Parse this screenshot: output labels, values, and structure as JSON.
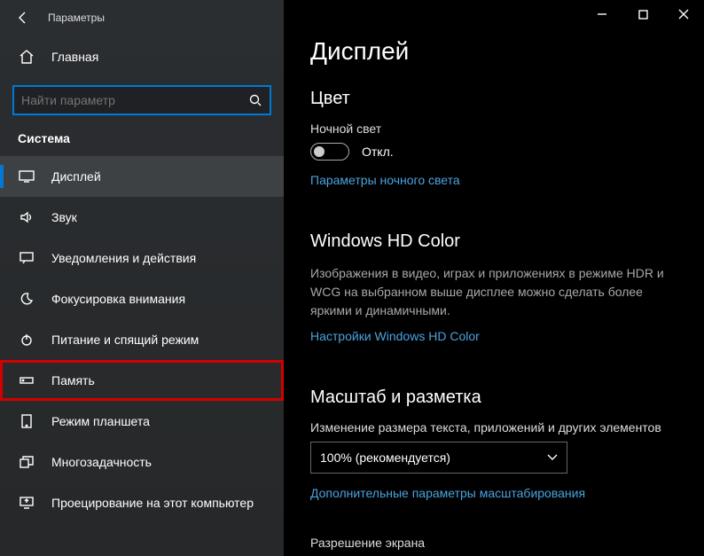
{
  "titlebar": {
    "title": "Параметры"
  },
  "home_label": "Главная",
  "search": {
    "placeholder": "Найти параметр"
  },
  "section_title": "Система",
  "nav": [
    {
      "label": "Дисплей"
    },
    {
      "label": "Звук"
    },
    {
      "label": "Уведомления и действия"
    },
    {
      "label": "Фокусировка внимания"
    },
    {
      "label": "Питание и спящий режим"
    },
    {
      "label": "Память"
    },
    {
      "label": "Режим планшета"
    },
    {
      "label": "Многозадачность"
    },
    {
      "label": "Проецирование на этот компьютер"
    }
  ],
  "content": {
    "page_title": "Дисплей",
    "color": {
      "heading": "Цвет",
      "night_light_label": "Ночной свет",
      "toggle_state": "Откл.",
      "link": "Параметры ночного света"
    },
    "hd": {
      "heading": "Windows HD Color",
      "body": "Изображения в видео, играх и приложениях в режиме HDR и WCG на выбранном выше дисплее можно сделать более яркими и динамичными.",
      "link": "Настройки Windows HD Color"
    },
    "scale": {
      "heading": "Масштаб и разметка",
      "label1": "Изменение размера текста, приложений и других элементов",
      "select_value": "100% (рекомендуется)",
      "link": "Дополнительные параметры масштабирования",
      "label2": "Разрешение экрана"
    }
  }
}
